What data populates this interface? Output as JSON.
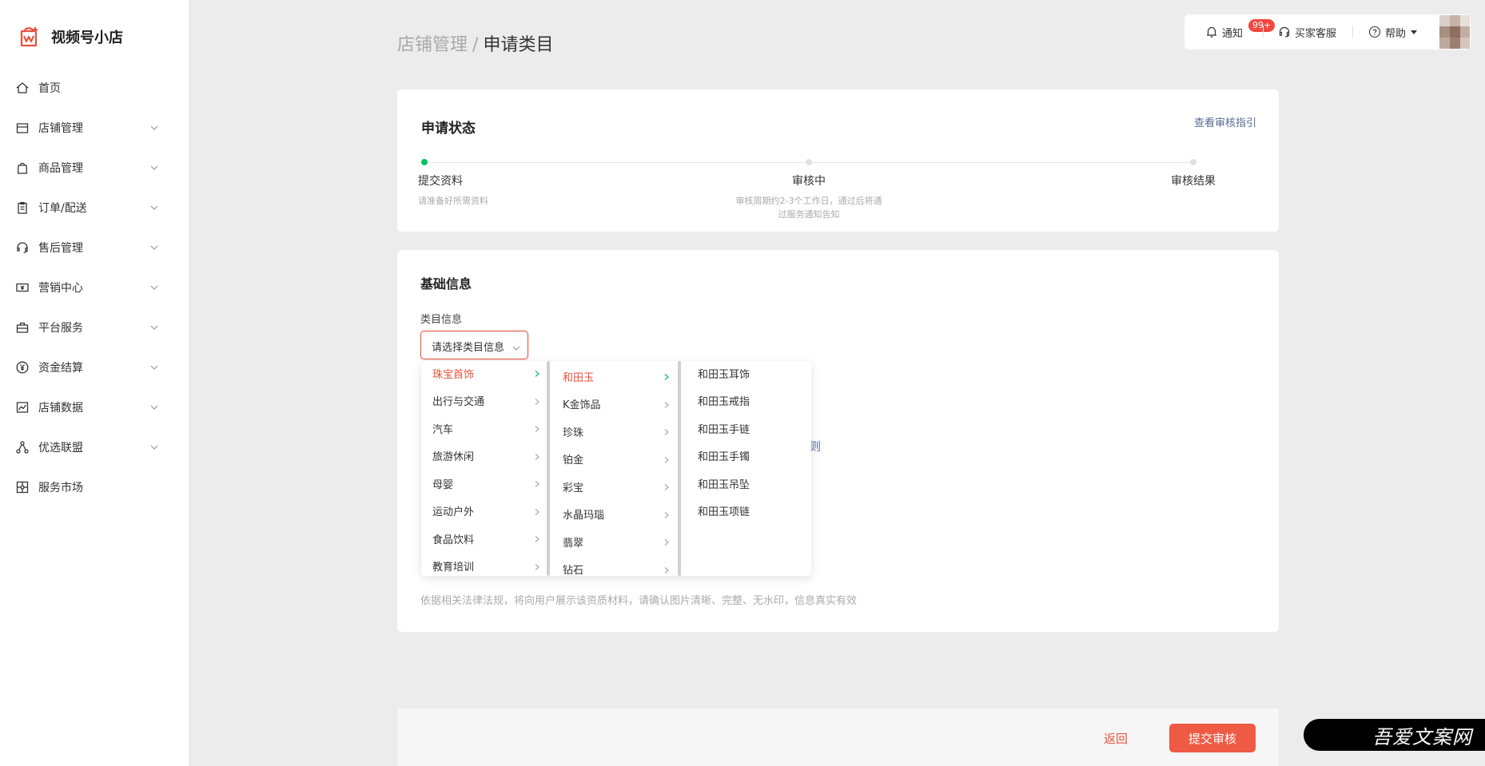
{
  "brand": {
    "name": "视频号小店",
    "accent": "#e5533d"
  },
  "sidebar": {
    "items": [
      {
        "label": "首页",
        "icon": "home-icon",
        "expandable": false
      },
      {
        "label": "店铺管理",
        "icon": "store-icon",
        "expandable": true
      },
      {
        "label": "商品管理",
        "icon": "bag-icon",
        "expandable": true
      },
      {
        "label": "订单/配送",
        "icon": "clipboard-icon",
        "expandable": true
      },
      {
        "label": "售后管理",
        "icon": "headset-icon",
        "expandable": true
      },
      {
        "label": "营销中心",
        "icon": "ticket-icon",
        "expandable": true
      },
      {
        "label": "平台服务",
        "icon": "briefcase-icon",
        "expandable": true
      },
      {
        "label": "资金结算",
        "icon": "yen-icon",
        "expandable": true
      },
      {
        "label": "店铺数据",
        "icon": "chart-icon",
        "expandable": true
      },
      {
        "label": "优选联盟",
        "icon": "network-icon",
        "expandable": true
      },
      {
        "label": "服务市场",
        "icon": "puzzle-icon",
        "expandable": false
      }
    ]
  },
  "breadcrumb": {
    "parent": "店铺管理",
    "separator": "/",
    "current": "申请类目"
  },
  "topbar": {
    "notify_label": "通知",
    "notify_badge": "99+",
    "service_label": "买家客服",
    "help_label": "帮助"
  },
  "status_card": {
    "title": "申请状态",
    "guide_link": "查看审核指引",
    "steps": [
      {
        "title": "提交资料",
        "desc_lines": [
          "请准备好所需资料"
        ],
        "state": "active"
      },
      {
        "title": "审核中",
        "desc_lines": [
          "审核周期约2-3个工作日，通过后将通",
          "过服务通知告知"
        ],
        "state": "pending"
      },
      {
        "title": "审核结果",
        "desc_lines": [],
        "state": "pending"
      }
    ]
  },
  "info_card": {
    "title": "基础信息",
    "field_label": "类目信息",
    "select_placeholder": "请选择类目信息",
    "partial_link": "则",
    "legal_note": "依据相关法律法规，将向用户展示该资质材料，请确认图片清晰、完整、无水印，信息真实有效"
  },
  "cascader": {
    "level1": [
      "珠宝首饰",
      "出行与交通",
      "汽车",
      "旅游休闲",
      "母婴",
      "运动户外",
      "食品饮料",
      "教育培训"
    ],
    "level1_selected": 0,
    "level2": [
      "和田玉",
      "K金饰品",
      "珍珠",
      "铂金",
      "彩宝",
      "水晶玛瑙",
      "翡翠",
      "钻石"
    ],
    "level2_selected": 0,
    "level3": [
      "和田玉耳饰",
      "和田玉戒指",
      "和田玉手链",
      "和田玉手镯",
      "和田玉吊坠",
      "和田玉项链"
    ]
  },
  "bottom_bar": {
    "back_label": "返回",
    "submit_label": "提交审核"
  },
  "watermark": "吾爱文案网",
  "colors": {
    "primary_red": "#ef5a44",
    "active_step": "#07c160",
    "link": "#576b95"
  }
}
